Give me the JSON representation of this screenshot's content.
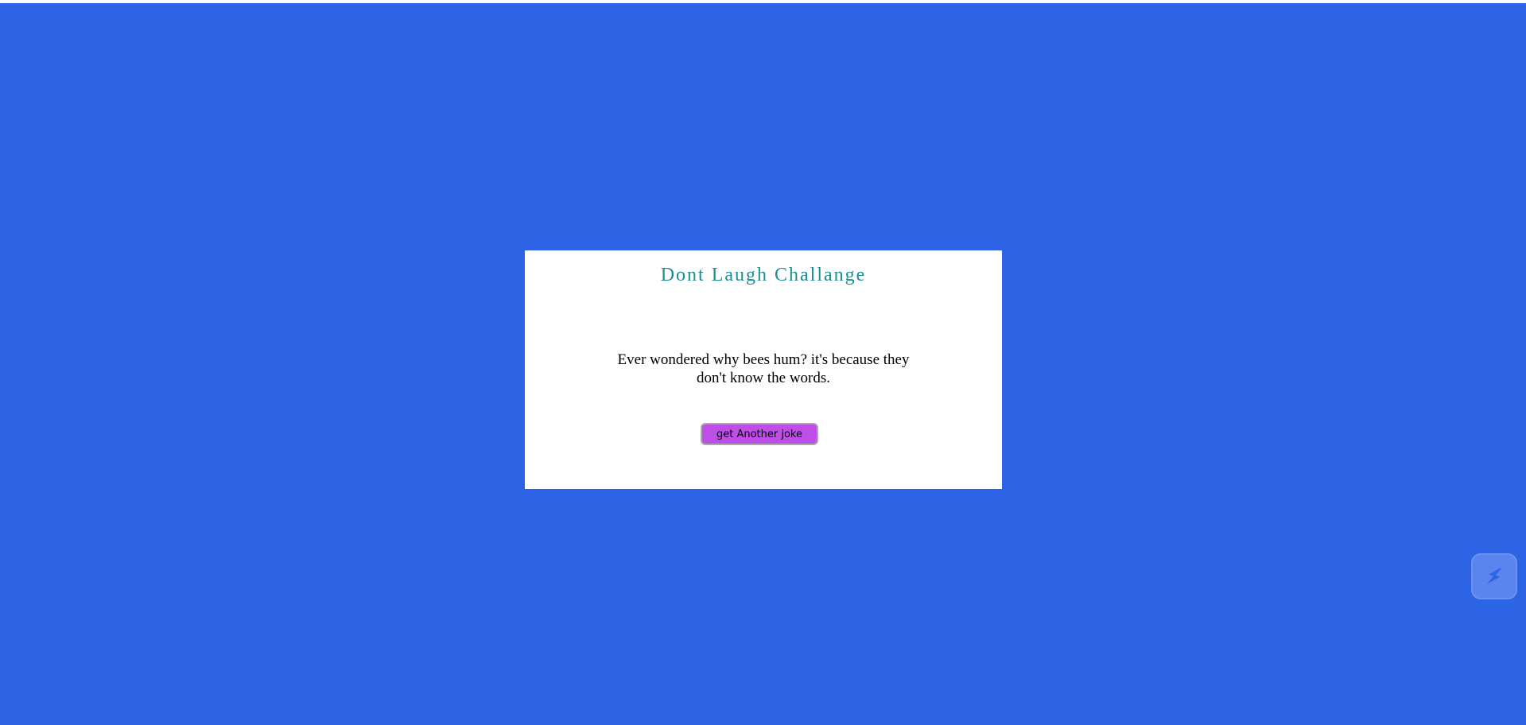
{
  "card": {
    "title": "Dont Laugh Challange",
    "joke": "Ever wondered why bees hum? it's because they don't know the words.",
    "button_label": "get Another joke"
  },
  "floating_widget": {
    "icon": "lightning-bolt-icon"
  },
  "colors": {
    "background": "#2d64e6",
    "card": "#ffffff",
    "title": "#1a8f93",
    "button": "#bf4ee8",
    "widget": "#5a84ee"
  }
}
